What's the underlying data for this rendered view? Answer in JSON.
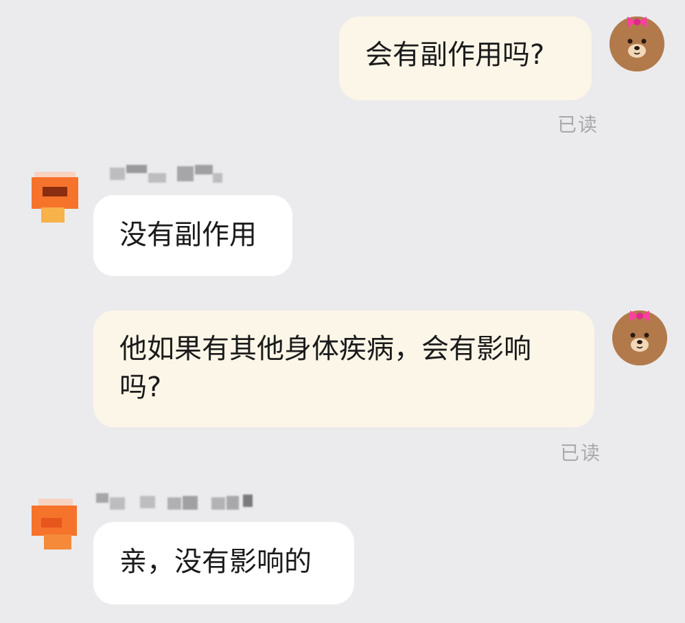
{
  "colors": {
    "background": "#ebebed",
    "outgoing_bubble": "#fcf6e8",
    "incoming_bubble": "#ffffff",
    "read_receipt": "#a9a9ab",
    "bear_fur": "#b27a4b",
    "bow_pink": "#ff3fa0",
    "avatar_orange": "#f5732a"
  },
  "messages": [
    {
      "direction": "outgoing",
      "text": "会有副作用吗?",
      "status": "已读",
      "avatar": "brown-bear-bow-icon"
    },
    {
      "direction": "incoming",
      "text": "没有副作用",
      "avatar": "pixelated-shop-avatar"
    },
    {
      "direction": "outgoing",
      "text_line1": "他如果有其他身体疾病，会有影响",
      "text_line2": "吗?",
      "status": "已读",
      "avatar": "brown-bear-bow-icon"
    },
    {
      "direction": "incoming",
      "text": "亲，没有影响的",
      "avatar": "pixelated-shop-avatar"
    }
  ]
}
